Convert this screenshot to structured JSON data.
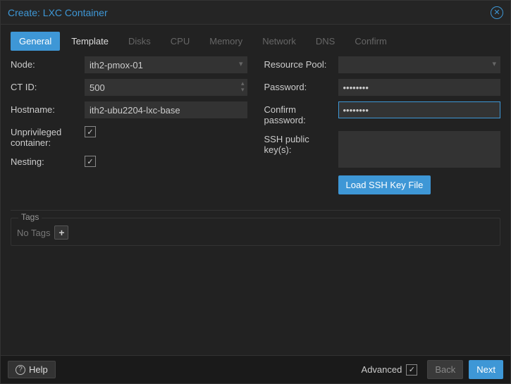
{
  "window": {
    "title": "Create: LXC Container"
  },
  "tabs": [
    {
      "label": "General",
      "state": "active"
    },
    {
      "label": "Template",
      "state": "enabled"
    },
    {
      "label": "Disks",
      "state": "disabled"
    },
    {
      "label": "CPU",
      "state": "disabled"
    },
    {
      "label": "Memory",
      "state": "disabled"
    },
    {
      "label": "Network",
      "state": "disabled"
    },
    {
      "label": "DNS",
      "state": "disabled"
    },
    {
      "label": "Confirm",
      "state": "disabled"
    }
  ],
  "left": {
    "node": {
      "label": "Node:",
      "value": "ith2-pmox-01"
    },
    "ctid": {
      "label": "CT ID:",
      "value": "500"
    },
    "hostname": {
      "label": "Hostname:",
      "value": "ith2-ubu2204-lxc-base"
    },
    "unpriv": {
      "label": "Unprivileged container:",
      "checked": true
    },
    "nesting": {
      "label": "Nesting:",
      "checked": true
    }
  },
  "right": {
    "pool": {
      "label": "Resource Pool:",
      "value": ""
    },
    "password": {
      "label": "Password:",
      "value": "••••••••"
    },
    "confirm": {
      "label": "Confirm password:",
      "value": "••••••••"
    },
    "sshkeys": {
      "label": "SSH public key(s):",
      "value": ""
    },
    "loadssh": "Load SSH Key File"
  },
  "tags": {
    "legend": "Tags",
    "empty": "No Tags"
  },
  "footer": {
    "help": "Help",
    "advanced": "Advanced",
    "advanced_checked": true,
    "back": "Back",
    "next": "Next"
  }
}
